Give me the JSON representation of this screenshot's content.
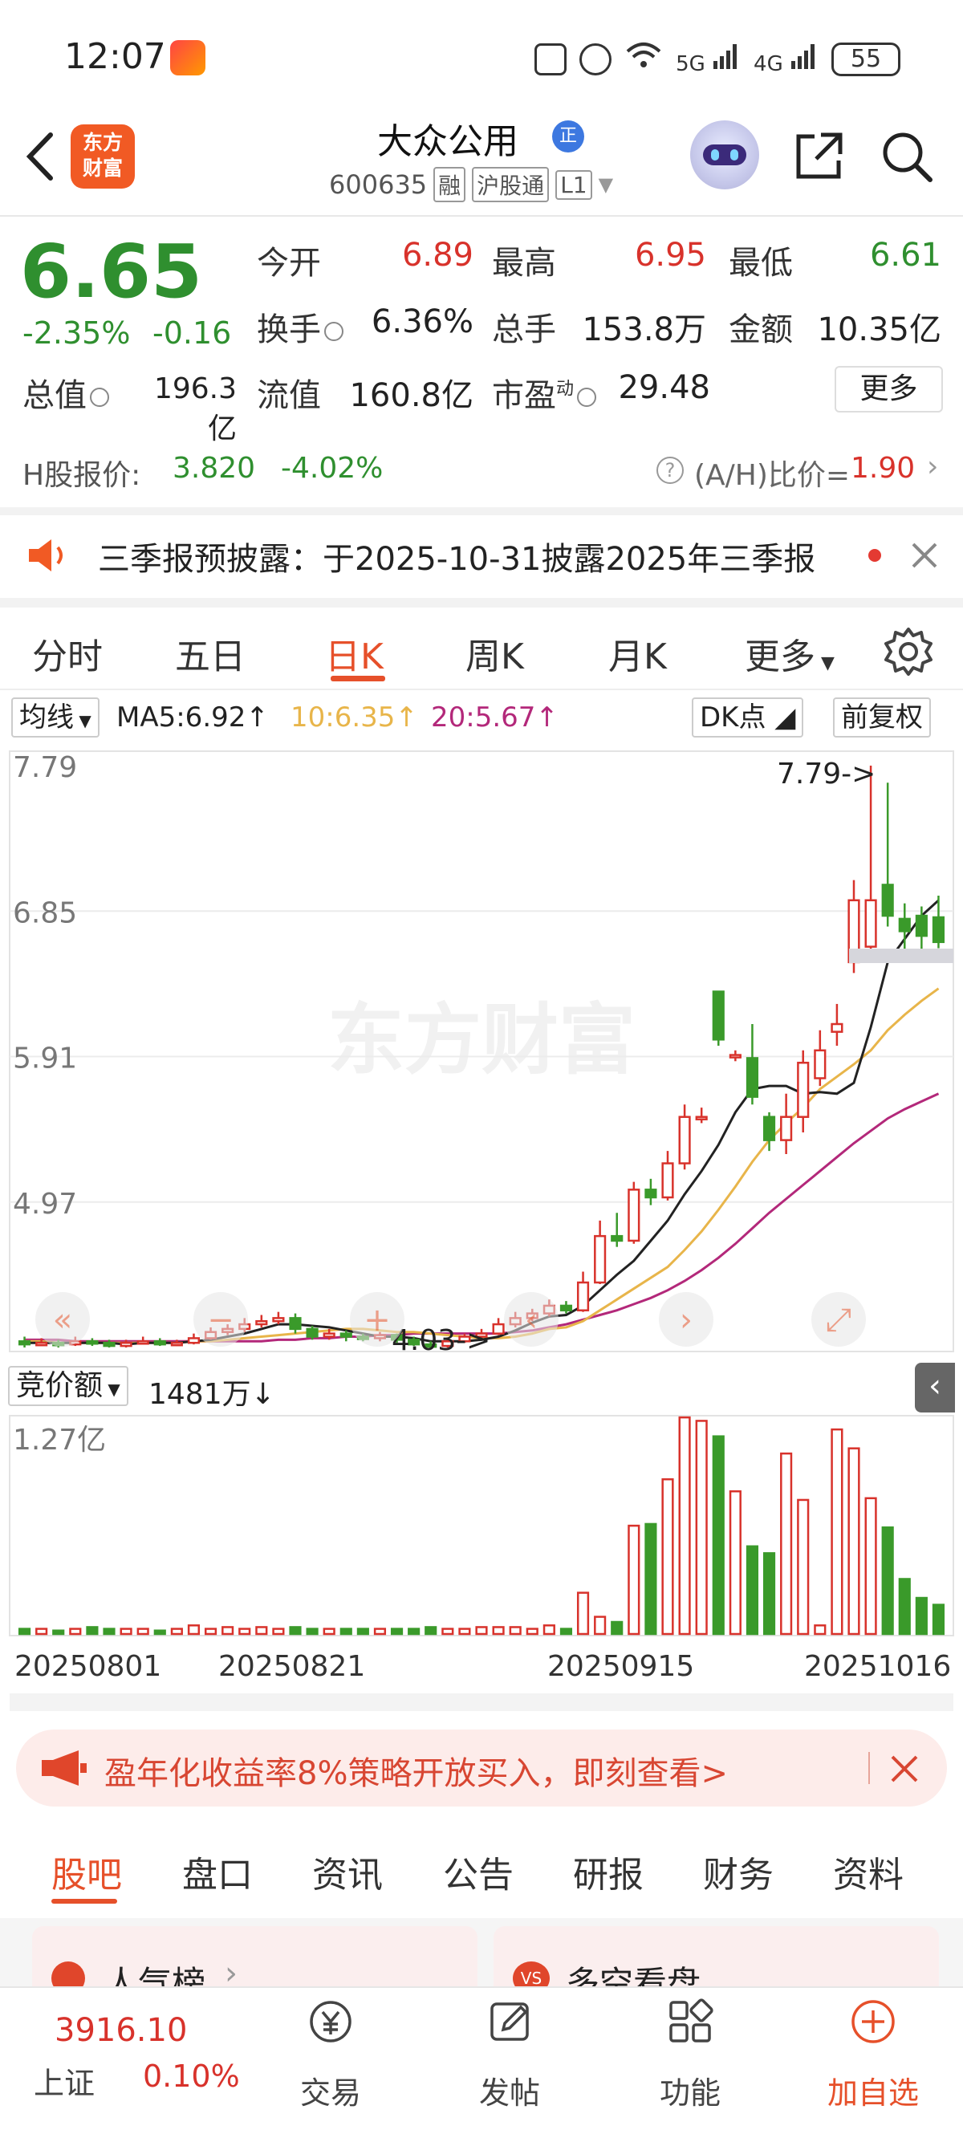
{
  "status_bar": {
    "time": "12:07",
    "battery": "55",
    "network1": "5G",
    "network2": "4G"
  },
  "header": {
    "logo_line1": "东方",
    "logo_line2": "财富",
    "stock_name": "大众公用",
    "name_badge": "正",
    "stock_code": "600635",
    "tags": [
      "融",
      "沪股通",
      "L1"
    ]
  },
  "quote": {
    "price": "6.65",
    "change_pct": "-2.35%",
    "change_amt": "-0.16",
    "open_label": "今开",
    "open": "6.89",
    "high_label": "最高",
    "high": "6.95",
    "low_label": "最低",
    "low": "6.61",
    "turnover_label": "换手",
    "turnover": "6.36%",
    "volume_label": "总手",
    "volume": "153.8万",
    "amount_label": "金额",
    "amount": "10.35亿",
    "mktcap_label": "总值",
    "mktcap": "196.3亿",
    "float_label": "流值",
    "float": "160.8亿",
    "pe_label": "市盈",
    "pe_sup": "动",
    "pe": "29.48",
    "more_label": "更多"
  },
  "hshare": {
    "label": "H股报价:",
    "price": "3.820",
    "change": "-4.02%",
    "ratio_label": "(A/H)比价=",
    "ratio": "1.90"
  },
  "notice": {
    "text": "三季报预披露：于2025-10-31披露2025年三季报"
  },
  "period_tabs": [
    "分时",
    "五日",
    "日K",
    "周K",
    "月K",
    "更多"
  ],
  "active_period": "日K",
  "chart_toolbar": {
    "indicator": "均线",
    "ma5": "MA5:6.92↑",
    "ma10": "10:6.35↑",
    "ma20": "20:5.67↑",
    "dk": "DK点",
    "adjust": "前复权"
  },
  "volume_toolbar": {
    "indicator": "竞价额",
    "value": "1481万↓",
    "max_label": "1.27亿"
  },
  "chart_data": {
    "type": "candlestick",
    "y_ticks": [
      "7.79",
      "6.85",
      "5.91",
      "4.97"
    ],
    "ylim": [
      4.03,
      7.79
    ],
    "max_annotation": "7.79->",
    "min_annotation": "4.03->",
    "x_ticks": [
      "20250801",
      "20250821",
      "20250915",
      "20251016"
    ],
    "watermark": "东方财富",
    "colors": {
      "up": "#d8322b",
      "down": "#3a9a2a",
      "ma5": "#222222",
      "ma10": "#e8b54a",
      "ma20": "#b3287a"
    },
    "candles": [
      {
        "o": 4.07,
        "c": 4.05,
        "h": 4.1,
        "l": 4.03
      },
      {
        "o": 4.05,
        "c": 4.06,
        "h": 4.09,
        "l": 4.04
      },
      {
        "o": 4.06,
        "c": 4.05,
        "h": 4.08,
        "l": 4.03
      },
      {
        "o": 4.05,
        "c": 4.07,
        "h": 4.1,
        "l": 4.04
      },
      {
        "o": 4.07,
        "c": 4.06,
        "h": 4.09,
        "l": 4.04
      },
      {
        "o": 4.06,
        "c": 4.04,
        "h": 4.08,
        "l": 4.03
      },
      {
        "o": 4.04,
        "c": 4.06,
        "h": 4.08,
        "l": 4.03
      },
      {
        "o": 4.06,
        "c": 4.07,
        "h": 4.1,
        "l": 4.05
      },
      {
        "o": 4.07,
        "c": 4.05,
        "h": 4.09,
        "l": 4.04
      },
      {
        "o": 4.05,
        "c": 4.06,
        "h": 4.08,
        "l": 4.04
      },
      {
        "o": 4.06,
        "c": 4.09,
        "h": 4.12,
        "l": 4.05
      },
      {
        "o": 4.09,
        "c": 4.13,
        "h": 4.16,
        "l": 4.08
      },
      {
        "o": 4.13,
        "c": 4.15,
        "h": 4.18,
        "l": 4.11
      },
      {
        "o": 4.15,
        "c": 4.18,
        "h": 4.22,
        "l": 4.13
      },
      {
        "o": 4.18,
        "c": 4.2,
        "h": 4.24,
        "l": 4.16
      },
      {
        "o": 4.2,
        "c": 4.22,
        "h": 4.26,
        "l": 4.18
      },
      {
        "o": 4.22,
        "c": 4.15,
        "h": 4.25,
        "l": 4.12
      },
      {
        "o": 4.15,
        "c": 4.1,
        "h": 4.17,
        "l": 4.08
      },
      {
        "o": 4.1,
        "c": 4.12,
        "h": 4.15,
        "l": 4.08
      },
      {
        "o": 4.12,
        "c": 4.1,
        "h": 4.14,
        "l": 4.07
      },
      {
        "o": 4.1,
        "c": 4.09,
        "h": 4.12,
        "l": 4.07
      },
      {
        "o": 4.09,
        "c": 4.11,
        "h": 4.13,
        "l": 4.07
      },
      {
        "o": 4.11,
        "c": 4.08,
        "h": 4.12,
        "l": 4.06
      },
      {
        "o": 4.08,
        "c": 4.05,
        "h": 4.1,
        "l": 4.04
      },
      {
        "o": 4.05,
        "c": 4.04,
        "h": 4.07,
        "l": 4.03
      },
      {
        "o": 4.04,
        "c": 4.07,
        "h": 4.09,
        "l": 4.03
      },
      {
        "o": 4.07,
        "c": 4.1,
        "h": 4.12,
        "l": 4.06
      },
      {
        "o": 4.1,
        "c": 4.12,
        "h": 4.15,
        "l": 4.09
      },
      {
        "o": 4.12,
        "c": 4.18,
        "h": 4.22,
        "l": 4.11
      },
      {
        "o": 4.18,
        "c": 4.22,
        "h": 4.26,
        "l": 4.16
      },
      {
        "o": 4.22,
        "c": 4.25,
        "h": 4.28,
        "l": 4.2
      },
      {
        "o": 4.25,
        "c": 4.3,
        "h": 4.34,
        "l": 4.23
      },
      {
        "o": 4.3,
        "c": 4.27,
        "h": 4.33,
        "l": 4.25
      },
      {
        "o": 4.27,
        "c": 4.45,
        "h": 4.52,
        "l": 4.26
      },
      {
        "o": 4.45,
        "c": 4.75,
        "h": 4.85,
        "l": 4.44
      },
      {
        "o": 4.75,
        "c": 4.72,
        "h": 4.9,
        "l": 4.68
      },
      {
        "o": 4.72,
        "c": 5.05,
        "h": 5.1,
        "l": 4.7
      },
      {
        "o": 5.05,
        "c": 5.0,
        "h": 5.12,
        "l": 4.95
      },
      {
        "o": 5.0,
        "c": 5.22,
        "h": 5.3,
        "l": 4.98
      },
      {
        "o": 5.22,
        "c": 5.52,
        "h": 5.6,
        "l": 5.18
      },
      {
        "o": 5.52,
        "c": 5.52,
        "h": 5.58,
        "l": 5.48
      },
      {
        "o": 6.33,
        "c": 6.02,
        "h": 6.33,
        "l": 5.98
      },
      {
        "o": 5.92,
        "c": 5.92,
        "h": 5.95,
        "l": 5.88
      },
      {
        "o": 5.9,
        "c": 5.65,
        "h": 6.12,
        "l": 5.6
      },
      {
        "o": 5.52,
        "c": 5.37,
        "h": 5.55,
        "l": 5.3
      },
      {
        "o": 5.37,
        "c": 5.52,
        "h": 5.67,
        "l": 5.28
      },
      {
        "o": 5.52,
        "c": 5.87,
        "h": 5.95,
        "l": 5.42
      },
      {
        "o": 5.77,
        "c": 5.95,
        "h": 6.08,
        "l": 5.72
      },
      {
        "o": 6.07,
        "c": 6.12,
        "h": 6.25,
        "l": 5.98
      },
      {
        "o": 6.52,
        "c": 6.92,
        "h": 7.05,
        "l": 6.45
      },
      {
        "o": 6.62,
        "c": 6.92,
        "h": 7.79,
        "l": 6.55
      },
      {
        "o": 7.02,
        "c": 6.82,
        "h": 7.68,
        "l": 6.75
      },
      {
        "o": 6.8,
        "c": 6.72,
        "h": 6.9,
        "l": 6.55
      },
      {
        "o": 6.82,
        "c": 6.69,
        "h": 6.88,
        "l": 6.6
      },
      {
        "o": 6.81,
        "c": 6.65,
        "h": 6.95,
        "l": 6.61
      }
    ],
    "volume": [
      0.3,
      0.3,
      0.2,
      0.3,
      0.4,
      0.3,
      0.3,
      0.3,
      0.2,
      0.3,
      0.5,
      0.3,
      0.4,
      0.3,
      0.4,
      0.3,
      0.4,
      0.3,
      0.3,
      0.3,
      0.3,
      0.3,
      0.3,
      0.3,
      0.4,
      0.3,
      0.3,
      0.4,
      0.4,
      0.4,
      0.3,
      0.5,
      0.3,
      2.4,
      1.0,
      0.7,
      6.3,
      6.4,
      9.0,
      12.6,
      12.4,
      11.5,
      8.3,
      5.1,
      4.7,
      10.5,
      7.8,
      0.5,
      11.9,
      10.8,
      7.9,
      6.2,
      3.2,
      2.1,
      1.7
    ],
    "ma5": [
      4.06,
      4.06,
      4.06,
      4.06,
      4.06,
      4.06,
      4.05,
      4.06,
      4.06,
      4.06,
      4.07,
      4.08,
      4.1,
      4.12,
      4.15,
      4.18,
      4.18,
      4.17,
      4.16,
      4.14,
      4.12,
      4.1,
      4.1,
      4.09,
      4.07,
      4.07,
      4.07,
      4.08,
      4.1,
      4.14,
      4.19,
      4.23,
      4.24,
      4.3,
      4.4,
      4.5,
      4.59,
      4.72,
      4.85,
      5.02,
      5.17,
      5.34,
      5.55,
      5.7,
      5.72,
      5.72,
      5.67,
      5.68,
      5.67,
      5.74,
      6.1,
      6.52,
      6.67,
      6.82,
      6.92
    ],
    "ma10": [
      4.07,
      4.07,
      4.06,
      4.06,
      4.06,
      4.06,
      4.06,
      4.06,
      4.06,
      4.06,
      4.07,
      4.07,
      4.08,
      4.09,
      4.1,
      4.11,
      4.12,
      4.13,
      4.14,
      4.15,
      4.15,
      4.14,
      4.13,
      4.13,
      4.12,
      4.11,
      4.1,
      4.09,
      4.09,
      4.1,
      4.12,
      4.15,
      4.16,
      4.2,
      4.27,
      4.34,
      4.41,
      4.48,
      4.55,
      4.66,
      4.78,
      4.92,
      5.07,
      5.23,
      5.37,
      5.48,
      5.58,
      5.7,
      5.78,
      5.86,
      5.95,
      6.08,
      6.18,
      6.27,
      6.35
    ],
    "ma20": [
      4.08,
      4.08,
      4.08,
      4.07,
      4.07,
      4.07,
      4.07,
      4.07,
      4.07,
      4.07,
      4.07,
      4.07,
      4.07,
      4.07,
      4.07,
      4.08,
      4.08,
      4.09,
      4.09,
      4.1,
      4.1,
      4.11,
      4.11,
      4.12,
      4.12,
      4.12,
      4.12,
      4.12,
      4.12,
      4.13,
      4.14,
      4.16,
      4.18,
      4.21,
      4.24,
      4.27,
      4.31,
      4.35,
      4.4,
      4.46,
      4.53,
      4.61,
      4.7,
      4.8,
      4.9,
      4.99,
      5.08,
      5.17,
      5.26,
      5.35,
      5.43,
      5.51,
      5.57,
      5.62,
      5.67
    ]
  },
  "banner": {
    "text": "盈年化收益率8%策略开放买入，即刻查看>"
  },
  "section_tabs": [
    "股吧",
    "盘口",
    "资讯",
    "公告",
    "研报",
    "财务",
    "资料"
  ],
  "cards": [
    "人气榜",
    "多空看盘"
  ],
  "bottom_nav": {
    "index_value": "3916.10",
    "index_name": "上证",
    "index_change": "0.10%",
    "items": [
      "交易",
      "发帖",
      "功能",
      "加自选"
    ]
  }
}
